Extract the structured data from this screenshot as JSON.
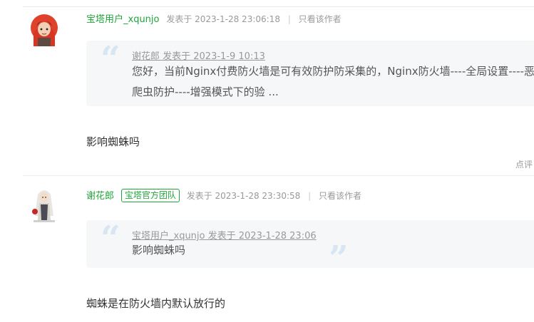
{
  "posts": [
    {
      "author": "宝塔用户_xqunjo",
      "badge": "",
      "posted": "发表于 2023-1-28 23:06:18",
      "only_author": "只看该作者",
      "quote": {
        "header": "谢花郎 发表于 2023-1-9 10:13",
        "text": "您好，当前Nginx付费防火墙是可有效防护防采集的，Nginx防火墙----全局设置----恶意爬虫防护----增强模式下的验 ..."
      },
      "content": "影响蜘蛛吗",
      "reply_label": "点评"
    },
    {
      "author": "谢花郎",
      "badge": "宝塔官方团队",
      "posted": "发表于 2023-1-28 23:30:58",
      "only_author": "只看该作者",
      "quote": {
        "header": "宝塔用户_xqunjo 发表于 2023-1-28 23:06",
        "text": "影响蜘蛛吗"
      },
      "content": "蜘蛛是在防火墙内默认放行的"
    }
  ],
  "colors": {
    "accent": "#20a53a",
    "quote_bg": "#f6f7f8",
    "quote_mark": "#d8e5f2"
  },
  "icons": [
    "quote-open-icon",
    "quote-close-icon"
  ]
}
